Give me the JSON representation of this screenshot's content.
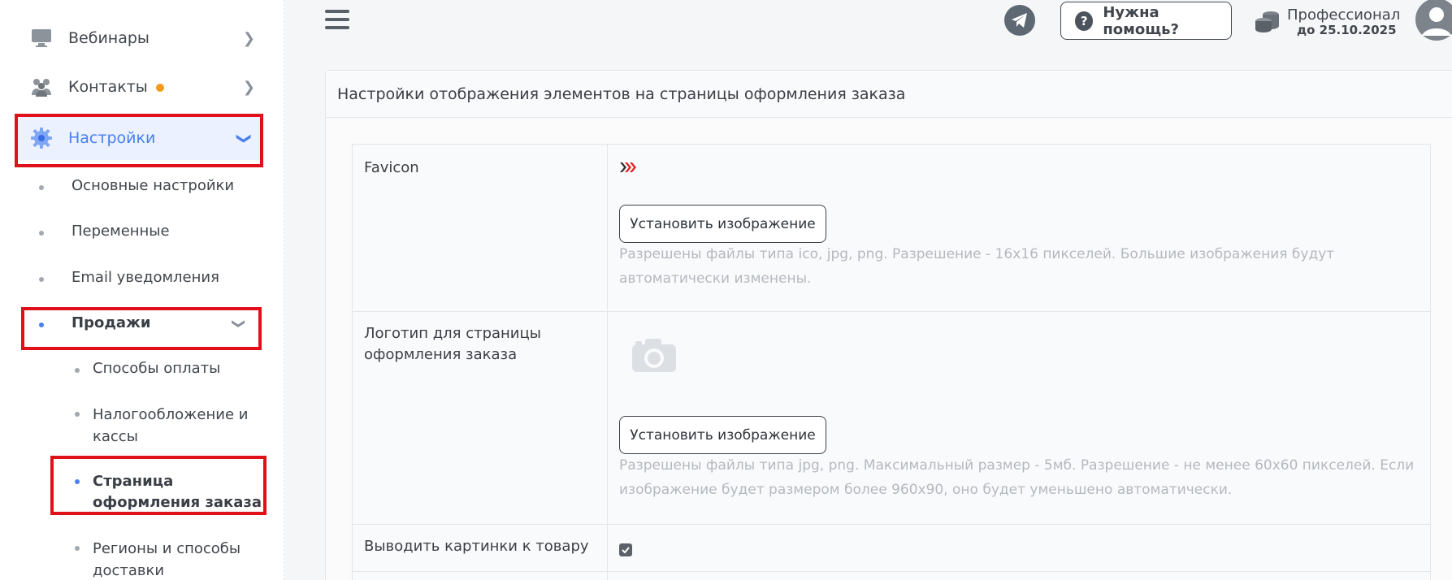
{
  "sidebar": {
    "items": [
      {
        "label": "Вебинары",
        "icon": "monitor-icon"
      },
      {
        "label": "Контакты",
        "icon": "users-icon",
        "badge_color": "#f29b1d"
      },
      {
        "label": "Настройки",
        "icon": "gear-icon",
        "active": true
      }
    ],
    "settings_sub": [
      "Основные настройки",
      "Переменные",
      "Email уведомления",
      "Продажи"
    ],
    "sales_sub": [
      "Способы оплаты",
      "Налогообложение и кассы",
      "Страница оформления заказа",
      "Регионы и способы доставки"
    ]
  },
  "topbar": {
    "help_label": "Нужна помощь?",
    "plan_name": "Профессионал",
    "plan_until": "до 25.10.2025"
  },
  "panel": {
    "title": "Настройки отображения элементов на страницы оформления заказа",
    "rows": [
      {
        "label": "Favicon",
        "button": "Установить изображение",
        "hint": "Разрешены файлы типа ico, jpg, png. Разрешение - 16x16 пикселей. Большие изображения будут автоматически изменены."
      },
      {
        "label": "Логотип для страницы оформления заказа",
        "button": "Установить изображение",
        "hint": "Разрешены файлы типа jpg, png. Максимальный размер - 5мб. Разрешение - не менее 60x60 пикселей. Если изображение будет размером более 960x90, оно будет уменьшено автоматически."
      },
      {
        "label": "Выводить картинки к товару",
        "checked": true
      }
    ]
  },
  "colors": {
    "accent": "#4a7ff2",
    "highlight": "#e0101b",
    "badge": "#f29b1d"
  }
}
